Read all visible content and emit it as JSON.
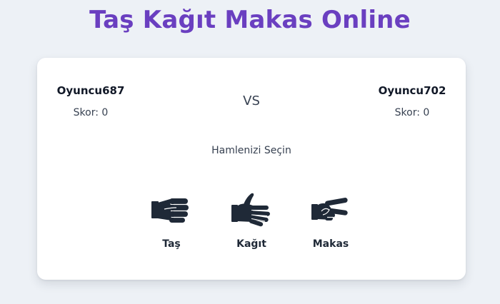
{
  "header": {
    "title": "Taş Kağıt Makas Online"
  },
  "players": {
    "left": {
      "name": "Oyuncu687",
      "score": "Skor: 0"
    },
    "right": {
      "name": "Oyuncu702",
      "score": "Skor: 0"
    },
    "vs_label": "VS"
  },
  "game": {
    "prompt": "Hamlenizi Seçin",
    "moves": [
      {
        "label": "Taş",
        "icon": "rock-fist-icon"
      },
      {
        "label": "Kağıt",
        "icon": "paper-hand-icon"
      },
      {
        "label": "Makas",
        "icon": "scissors-hand-icon"
      }
    ]
  },
  "colors": {
    "title": "#6a3fc0",
    "background": "#edf1f6",
    "card": "#ffffff",
    "icon": "#1f2937"
  }
}
